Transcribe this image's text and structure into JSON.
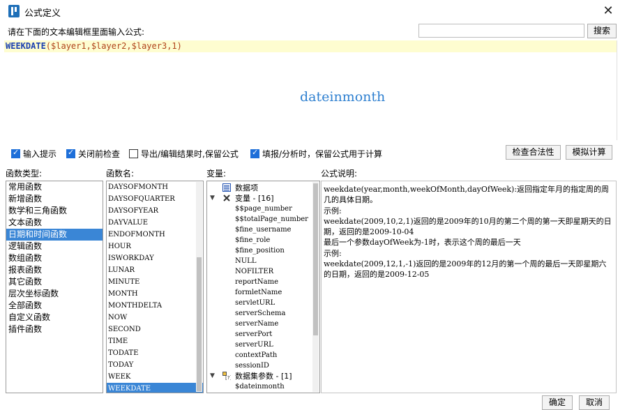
{
  "window": {
    "title": "公式定义",
    "close_symbol": "✕"
  },
  "prompt": "请在下面的文本编辑框里面输入公式:",
  "search": {
    "value": "",
    "placeholder": "",
    "button": "搜索"
  },
  "editor": {
    "formula_fn": "WEEKDATE",
    "formula_args": "($layer1,$layer2,$layer3,1)",
    "hint": "dateinmonth"
  },
  "options": [
    {
      "label": "输入提示",
      "checked": true
    },
    {
      "label": "关闭前检查",
      "checked": true
    },
    {
      "label": "导出/编辑结果时,保留公式",
      "checked": false
    },
    {
      "label": "填报/分析时，保留公式用于计算",
      "checked": true
    }
  ],
  "buttons": {
    "check_validity": "检查合法性",
    "simulate": "模拟计算",
    "ok": "确定",
    "cancel": "取消"
  },
  "labels": {
    "categories": "函数类型:",
    "functions": "函数名:",
    "variables": "变量:",
    "description": "公式说明:"
  },
  "categories": [
    {
      "label": "常用函数",
      "selected": false
    },
    {
      "label": "新增函数",
      "selected": false
    },
    {
      "label": "数学和三角函数",
      "selected": false
    },
    {
      "label": "文本函数",
      "selected": false
    },
    {
      "label": "日期和时间函数",
      "selected": true
    },
    {
      "label": "逻辑函数",
      "selected": false
    },
    {
      "label": "数组函数",
      "selected": false
    },
    {
      "label": "报表函数",
      "selected": false
    },
    {
      "label": "其它函数",
      "selected": false
    },
    {
      "label": "层次坐标函数",
      "selected": false
    },
    {
      "label": "全部函数",
      "selected": false
    },
    {
      "label": "自定义函数",
      "selected": false
    },
    {
      "label": "插件函数",
      "selected": false
    }
  ],
  "functions": [
    {
      "label": "DAYSOFMONTH",
      "selected": false
    },
    {
      "label": "DAYSOFQUARTER",
      "selected": false
    },
    {
      "label": "DAYSOFYEAR",
      "selected": false
    },
    {
      "label": "DAYVALUE",
      "selected": false
    },
    {
      "label": "ENDOFMONTH",
      "selected": false
    },
    {
      "label": "HOUR",
      "selected": false
    },
    {
      "label": "ISWORKDAY",
      "selected": false
    },
    {
      "label": "LUNAR",
      "selected": false
    },
    {
      "label": "MINUTE",
      "selected": false
    },
    {
      "label": "MONTH",
      "selected": false
    },
    {
      "label": "MONTHDELTA",
      "selected": false
    },
    {
      "label": "NOW",
      "selected": false
    },
    {
      "label": "SECOND",
      "selected": false
    },
    {
      "label": "TIME",
      "selected": false
    },
    {
      "label": "TODATE",
      "selected": false
    },
    {
      "label": "TODAY",
      "selected": false
    },
    {
      "label": "WEEK",
      "selected": false
    },
    {
      "label": "WEEKDATE",
      "selected": true
    }
  ],
  "variables_tree": {
    "data_item": "数据项",
    "vars_group": "变量 - [16]",
    "vars": [
      "$$page_number",
      "$$totalPage_number",
      "$fine_username",
      "$fine_role",
      "$fine_position",
      "NULL",
      "NOFILTER",
      "reportName",
      "formletName",
      "servletURL",
      "serverSchema",
      "serverName",
      "serverPort",
      "serverURL",
      "contextPath",
      "sessionID"
    ],
    "params_group": "数据集参数 - [1]",
    "params": [
      "$dateinmonth"
    ]
  },
  "description": [
    "weekdate(year,month,weekOfMonth,dayOfWeek):返回指定年月的指定周的周几的具体日期。",
    "示例:",
    "weekdate(2009,10,2,1)返回的是2009年的10月的第二个周的第一天即星期天的日期，返回的是2009-10-04",
    "最后一个参数dayOfWeek为-1时，表示这个周的最后一天",
    "示例:",
    "weekdate(2009,12,1,-1)返回的是2009年的12月的第一个周的最后一天即星期六的日期，返回的是2009-12-05"
  ]
}
